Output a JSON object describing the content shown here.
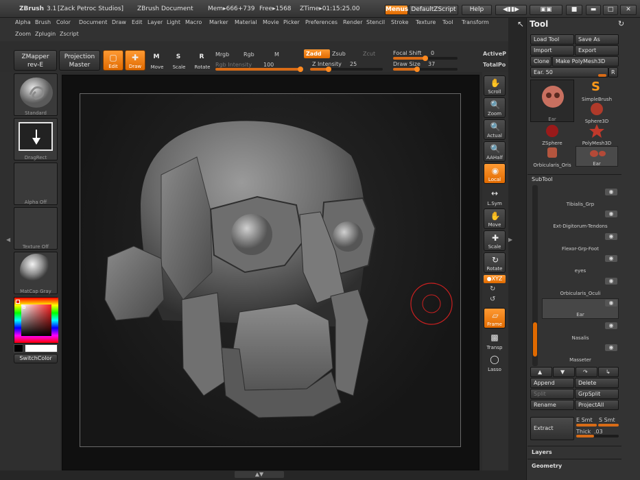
{
  "titlebar": {
    "app": "ZBrush",
    "version": "3.1",
    "studio": "[Zack Petroc Studios]",
    "doc": "ZBrush Document",
    "mem": "Mem▸666+739",
    "free": "Free▸1568",
    "ztime": "ZTime▸01:15:25.00",
    "menus_btn": "Menus",
    "script_btn": "DefaultZScript",
    "help_btn": "Help"
  },
  "menubar": {
    "row1": [
      "Alpha",
      "Brush",
      "Color",
      "Document",
      "Draw",
      "Edit",
      "Layer",
      "Light",
      "Macro",
      "Marker",
      "Material",
      "Movie",
      "Picker",
      "Preferences",
      "Render",
      "Stencil",
      "Stroke",
      "Texture",
      "Tool",
      "Transform"
    ],
    "row2": [
      "Zoom",
      "Zplugin",
      "Zscript"
    ]
  },
  "toolbar": {
    "zmapper": "ZMapper",
    "zmapper_sub": "rev-E",
    "projection": "Projection",
    "projection_sub": "Master",
    "edit": "Edit",
    "draw": "Draw",
    "move": "Move",
    "scale": "Scale",
    "rotate": "Rotate",
    "move_key": "M",
    "scale_key": "S",
    "rotate_key": "R",
    "mrgb": "Mrgb",
    "rgb": "Rgb",
    "m": "M",
    "rgb_intensity": "Rgb Intensity",
    "rgb_intensity_val": "100",
    "zadd": "Zadd",
    "zsub": "Zsub",
    "zcut": "Zcut",
    "z_intensity": "Z Intensity",
    "z_intensity_val": "25",
    "focal_shift": "Focal Shift",
    "focal_shift_val": "0",
    "draw_size": "Draw Size",
    "draw_size_val": "37",
    "active_points": "ActiveP",
    "total_points": "TotalPo"
  },
  "sliders": {
    "rgb_intensity": 1.0,
    "z_intensity": 0.25,
    "focal_shift": 0.5,
    "draw_size": 0.37
  },
  "leftbar": {
    "standard": "Standard",
    "dragrect": "DragRect",
    "alpha_off": "Alpha Off",
    "texture_off": "Texture Off",
    "matcap": "MatCap Gray",
    "switchcolor": "SwitchColor"
  },
  "dock": {
    "scroll": "Scroll",
    "zoom": "Zoom",
    "actual": "Actual",
    "aahalf": "AAHalf",
    "local": "Local",
    "lsym": "L.Sym",
    "move": "Move",
    "scale": "Scale",
    "rotate": "Rotate",
    "xyz": "XYZ",
    "frame": "Frame",
    "transp": "Transp",
    "lasso": "Lasso"
  },
  "tool_panel": {
    "title": "Tool",
    "load_tool": "Load Tool",
    "save_as": "Save As",
    "import": "Import",
    "export": "Export",
    "ear_label": "Ear.",
    "ear_value": "50",
    "r": "R",
    "clone": "Clone",
    "make_polymesh": "Make PolyMesh3D",
    "tools": [
      "Ear",
      "SimpleBrush",
      "Sphere3D",
      "ZSphere",
      "PolyMesh3D",
      "Orbicularis_Oris",
      "Ear"
    ],
    "subtool_title": "SubTool",
    "subtools": [
      "Tibialis_Grp",
      "Ext-Digitorum-Tendons",
      "Flexor-Grp-Foot",
      "eyes",
      "Orbicularis_Oculi",
      "Ear",
      "Nasalis",
      "Masseter"
    ],
    "append": "Append",
    "delete": "Delete",
    "split": "Split",
    "grpsplit": "GrpSplit",
    "rename": "Rename",
    "projectall": "ProjectAll",
    "extract": "Extract",
    "e_smt": "E Smt",
    "s_smt": "S Smt",
    "thick_label": "Thick",
    "thick_value": ".03",
    "layers": "Layers",
    "geometry": "Geometry"
  },
  "colors": {
    "accent": "#e8761a",
    "panel": "#333333",
    "canvas": "#151515"
  }
}
